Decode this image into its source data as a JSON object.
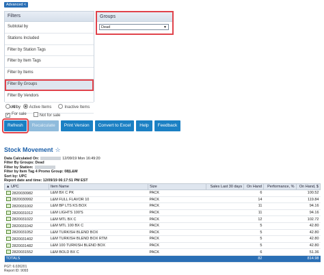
{
  "advanced_label": "Advanced <",
  "filters": {
    "header": "Filters",
    "items": [
      "Subtotal by",
      "Stations Included",
      "Filter by Station Tags",
      "Filter by Item Tags",
      "Filter by Items",
      "Filter By Groups",
      "Filter By Vendors",
      "Sort by"
    ]
  },
  "groups": {
    "header": "Groups",
    "selected": "Dead"
  },
  "radios": [
    "All",
    "Active Items",
    "Inactive Items"
  ],
  "checkboxes": [
    "For sale",
    "Not for sale"
  ],
  "buttons": {
    "refresh": "Refresh",
    "recalculate": "Recalculate",
    "print": "Print Version",
    "excel": "Convert to Excel",
    "help": "Help",
    "feedback": "Feedback"
  },
  "report": {
    "title": "Stock Movement",
    "data_calc_label": "Data Calculated On:",
    "data_calc_value": "12/09/19 Mon 16:49:20",
    "groups_line": "Filter By Groups: Dead",
    "station_line": "Filter by Station:",
    "item_tag_line": "Filter by Item Tag 4 Promo Group: 08|L&M",
    "sort_line": "Sort by: UPC",
    "report_date_line": "Report date and time: 12/09/19 06:17:51 PM EST"
  },
  "table": {
    "headers": [
      "UPC",
      "Item Name",
      "Size",
      "Sales Last 30 days",
      "On Hand",
      "Performance, %",
      "On Hand, $"
    ],
    "rows": [
      [
        "2820030982",
        "L&M BX C PK",
        "PACK",
        "",
        "6",
        "",
        "100.52"
      ],
      [
        "2820030992",
        "L&M FULL FLAVOR 10",
        "PACK",
        "",
        "14",
        "",
        "119.84"
      ],
      [
        "2820031002",
        "L&M BP LTS KS BOX",
        "PACK",
        "",
        "11",
        "",
        "94.16"
      ],
      [
        "2820031012",
        "L&M LIGHTS 100'S",
        "PACK",
        "",
        "11",
        "",
        "94.16"
      ],
      [
        "2820031022",
        "L&M MTL BX C",
        "PACK",
        "",
        "12",
        "",
        "102.72"
      ],
      [
        "2820031042",
        "L&M MTL 100 BX C",
        "PACK",
        "",
        "5",
        "",
        "42.80"
      ],
      [
        "2820031052",
        "L&M TURKISH BLEND BOX",
        "PACK",
        "",
        "5",
        "",
        "42.80"
      ],
      [
        "2820031402",
        "L&M TURKISH BLEND BOX RTM",
        "PACK",
        "",
        "5",
        "",
        "42.80"
      ],
      [
        "2820031482",
        "L&M 100 TURKISH BLEND BOX",
        "PACK",
        "",
        "5",
        "",
        "42.80"
      ],
      [
        "2820031552",
        "L&M BOLD BX C",
        "PACK",
        "",
        "6",
        "",
        "51.36"
      ]
    ],
    "totals": [
      "TOTALS",
      "",
      "",
      "",
      "82",
      "",
      "814.98"
    ]
  },
  "footer": {
    "pgt": "PGT: 6.026201",
    "report_id": "Report ID: 9093"
  },
  "colors": {
    "accent": "#1b80c4",
    "highlight": "#e0424a",
    "title": "#1a5ea8"
  }
}
